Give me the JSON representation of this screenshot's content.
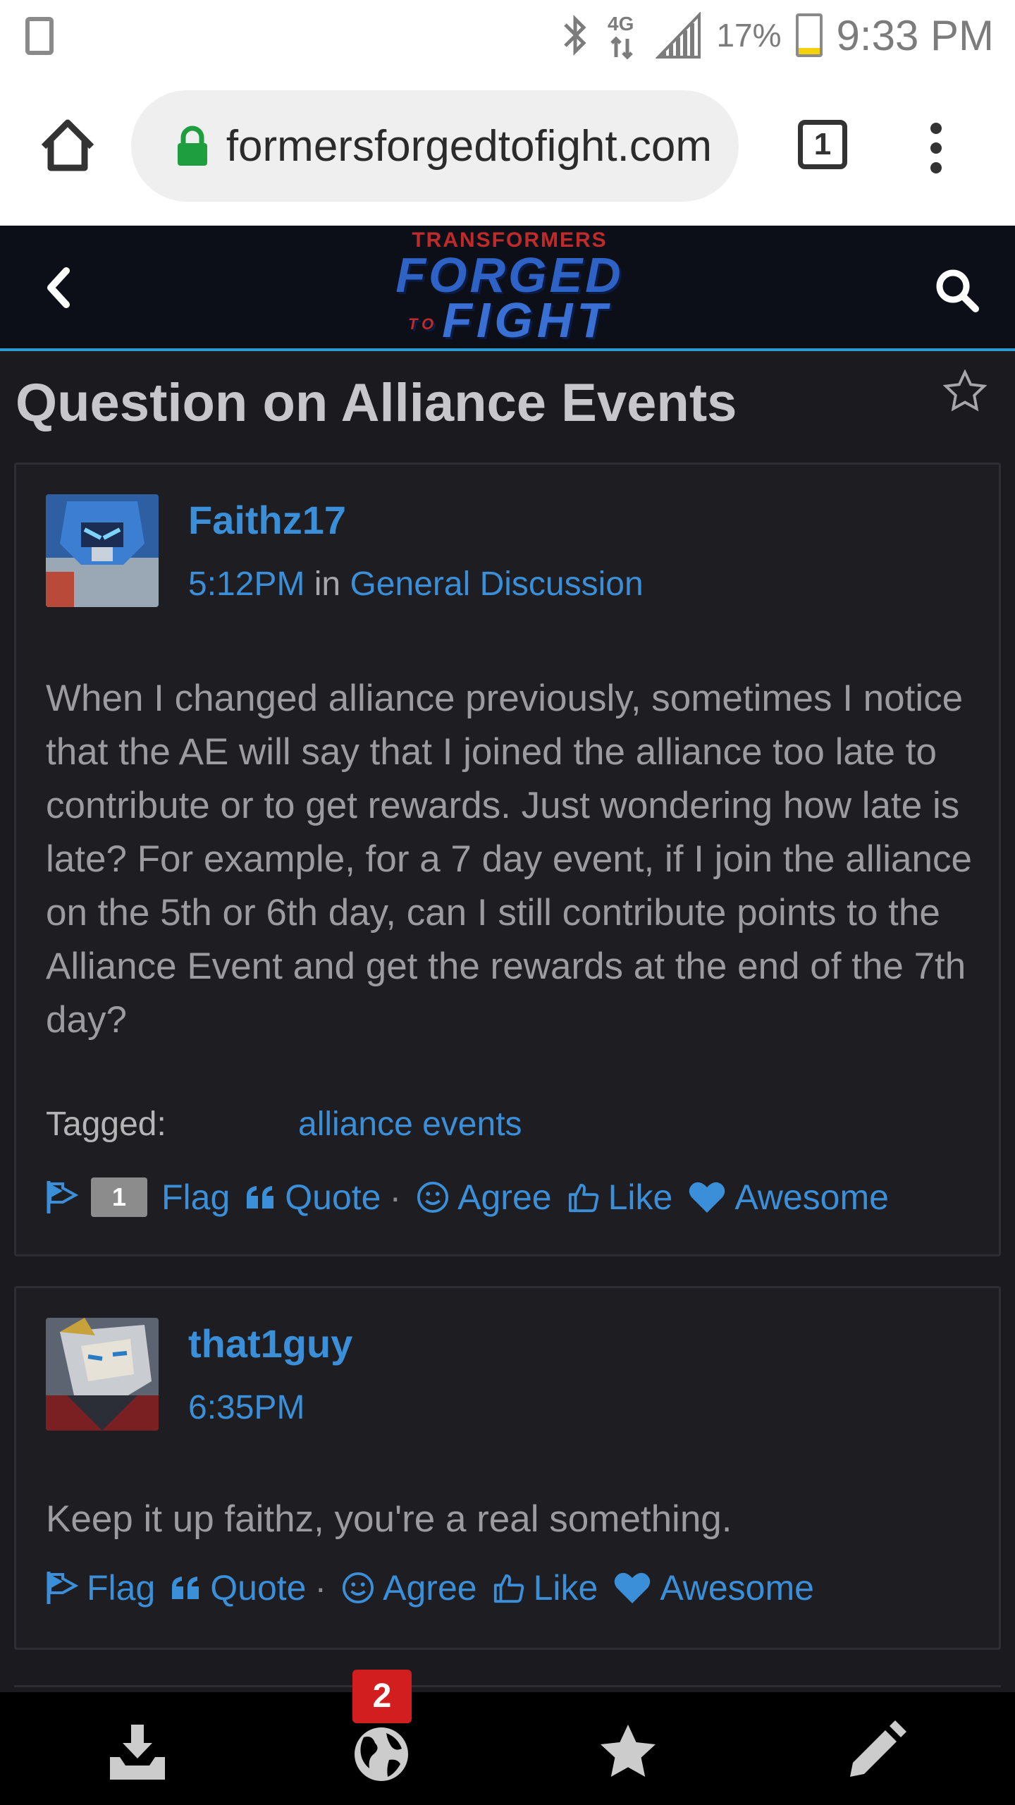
{
  "status_bar": {
    "battery_percent": "17%",
    "time": "9:33 PM",
    "network": "4G",
    "icons": [
      "phone-icon",
      "bluetooth-icon",
      "4g-icon",
      "signal-icon",
      "battery-icon"
    ]
  },
  "browser": {
    "url": "transformersforgedtofight.com",
    "tab_count": "1",
    "icons": [
      "home-icon",
      "lock-icon",
      "tabs-icon",
      "menu-icon"
    ]
  },
  "site_header": {
    "logo_top": "TRANSFORMERS",
    "logo_mid": "FORGED",
    "logo_to": "TO",
    "logo_bot": "FIGHT",
    "icons": [
      "back-icon",
      "search-icon"
    ]
  },
  "discussion": {
    "title": "Question on Alliance Events"
  },
  "posts": [
    {
      "author": "Faithz17",
      "time": "5:12PM",
      "in_label": "in",
      "category": "General Discussion",
      "body": "When I changed alliance previously, sometimes I notice that the AE will say that I joined the alliance too late to contribute or to get rewards. Just wondering how late is late? For example, for a 7 day event, if I join the alliance on the 5th or 6th day, can I still contribute points to the Alliance Event and get the rewards at the end of the 7th day?",
      "tagged_label": "Tagged:",
      "tag": "alliance events",
      "flag_count": "1",
      "reactions": {
        "flag": "Flag",
        "quote": "Quote",
        "sep": "·",
        "agree": "Agree",
        "like": "Like",
        "awesome": "Awesome"
      }
    },
    {
      "author": "that1guy",
      "time": "6:35PM",
      "body": "Keep it up faithz, you're a real something.",
      "reactions": {
        "flag": "Flag",
        "quote": "Quote",
        "sep": "·",
        "agree": "Agree",
        "like": "Like",
        "awesome": "Awesome"
      }
    }
  ],
  "bottom_nav": {
    "notification_count": "2",
    "icons": [
      "inbox-download-icon",
      "globe-icon",
      "bookmark-star-icon",
      "pencil-icon"
    ]
  },
  "colors": {
    "accent_blue": "#3a8fd8",
    "header_border": "#2d9ad1",
    "background": "#1b1b1f",
    "badge_red": "#d21e1e"
  }
}
